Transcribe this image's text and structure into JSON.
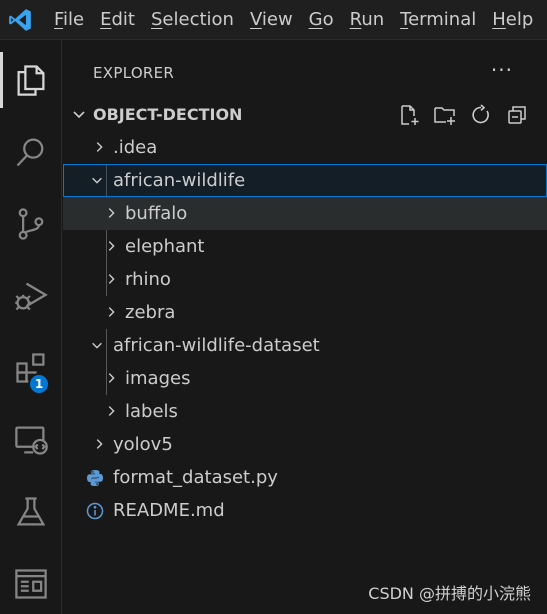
{
  "menu": {
    "items": [
      {
        "accel": "F",
        "rest": "ile"
      },
      {
        "accel": "E",
        "rest": "dit"
      },
      {
        "accel": "S",
        "rest": "election"
      },
      {
        "accel": "V",
        "rest": "iew"
      },
      {
        "accel": "G",
        "rest": "o"
      },
      {
        "accel": "R",
        "rest": "un"
      },
      {
        "accel": "T",
        "rest": "erminal"
      },
      {
        "accel": "H",
        "rest": "elp"
      }
    ]
  },
  "activity": {
    "extensions_badge": "1"
  },
  "sidebar": {
    "title": "EXPLORER",
    "more": "···",
    "section_title": "OBJECT-DECTION"
  },
  "tree": [
    {
      "label": ".idea",
      "kind": "folder",
      "expanded": false
    },
    {
      "label": "african-wildlife",
      "kind": "folder",
      "expanded": true,
      "selected": true
    },
    {
      "label": "buffalo",
      "kind": "folder",
      "expanded": false
    },
    {
      "label": "elephant",
      "kind": "folder",
      "expanded": false
    },
    {
      "label": "rhino",
      "kind": "folder",
      "expanded": false
    },
    {
      "label": "zebra",
      "kind": "folder",
      "expanded": false
    },
    {
      "label": "african-wildlife-dataset",
      "kind": "folder",
      "expanded": true
    },
    {
      "label": "images",
      "kind": "folder",
      "expanded": false
    },
    {
      "label": "labels",
      "kind": "folder",
      "expanded": false
    },
    {
      "label": "yolov5",
      "kind": "folder",
      "expanded": false
    },
    {
      "label": "format_dataset.py",
      "kind": "file",
      "icon": "python-icon"
    },
    {
      "label": "README.md",
      "kind": "file",
      "icon": "info-icon"
    }
  ],
  "watermark": "CSDN @拼搏的小浣熊",
  "colors": {
    "accent": "#0078d4",
    "background": "#181818",
    "text": "#cccccc"
  }
}
